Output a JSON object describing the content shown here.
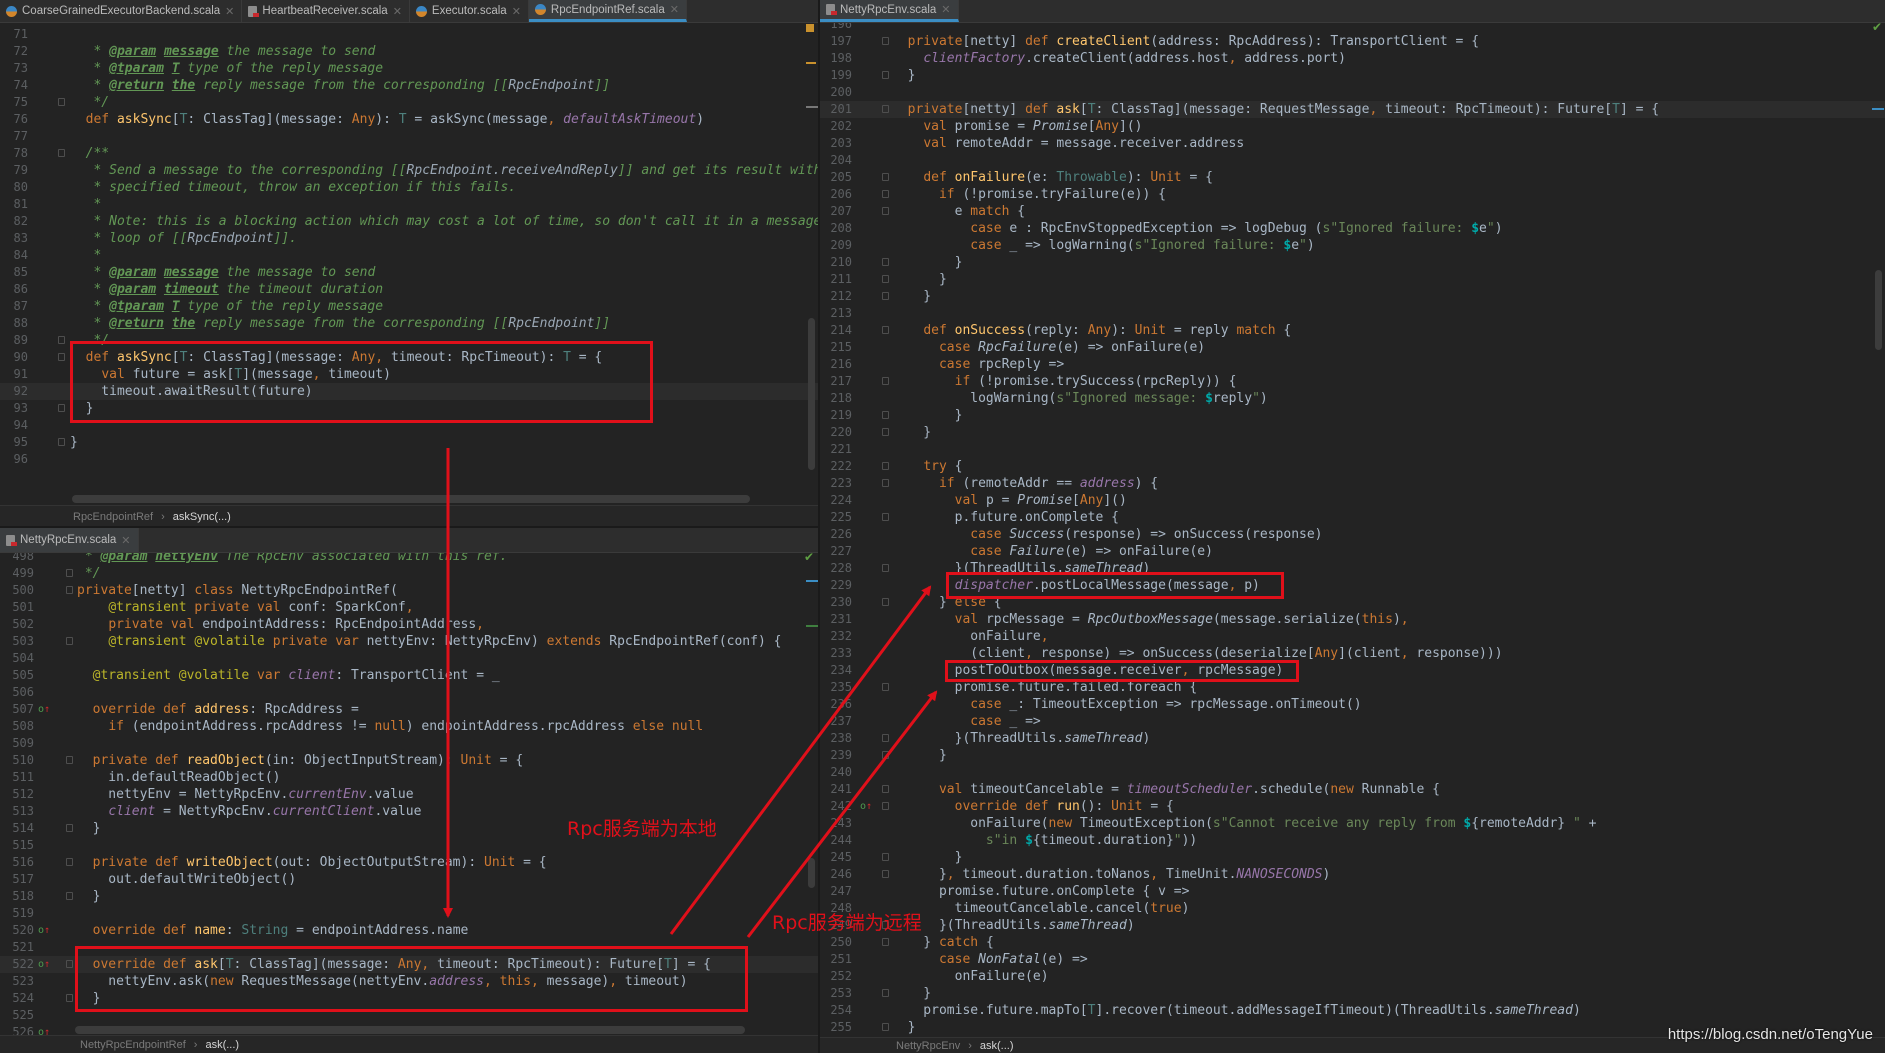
{
  "colors": {
    "annotation_red": "#e0101a",
    "active_tab_accent": "#3b8ec4",
    "background": "#232323"
  },
  "left_top": {
    "tabs": [
      {
        "label": "CoarseGrainedExecutorBackend.scala",
        "icon": "scala-class-icon",
        "active": false
      },
      {
        "label": "HeartbeatReceiver.scala",
        "icon": "scala-file-icon",
        "active": false
      },
      {
        "label": "Executor.scala",
        "icon": "scala-class-icon",
        "active": false
      },
      {
        "label": "RpcEndpointRef.scala",
        "icon": "scala-class-icon",
        "active": true
      }
    ],
    "first_line": 71,
    "current_line": 92,
    "lines": [
      "",
      "   * @param message the message to send",
      "   * @tparam T type of the reply message",
      "   * @return the reply message from the corresponding [[RpcEndpoint]]",
      "   */",
      "  def askSync[T: ClassTag](message: Any): T = askSync(message, defaultAskTimeout)",
      "",
      "  /**",
      "   * Send a message to the corresponding [[RpcEndpoint.receiveAndReply]] and get its result within a",
      "   * specified timeout, throw an exception if this fails.",
      "   *",
      "   * Note: this is a blocking action which may cost a lot of time, so don't call it in a message",
      "   * loop of [[RpcEndpoint]].",
      "   *",
      "   * @param message the message to send",
      "   * @param timeout the timeout duration",
      "   * @tparam T type of the reply message",
      "   * @return the reply message from the corresponding [[RpcEndpoint]]",
      "   */",
      "  def askSync[T: ClassTag](message: Any, timeout: RpcTimeout): T = {",
      "    val future = ask[T](message, timeout)",
      "    timeout.awaitResult(future)",
      "  }",
      "",
      "}",
      ""
    ],
    "breadcrumb": [
      "RpcEndpointRef",
      "askSync(...)"
    ]
  },
  "left_bottom": {
    "tabs": [
      {
        "label": "NettyRpcEnv.scala",
        "icon": "scala-file-icon",
        "active": false
      }
    ],
    "first_line": 498,
    "current_line": 522,
    "override_marks": [
      507,
      520,
      522,
      526
    ],
    "lines": [
      " * @param nettyEnv The RpcEnv associated with this ref.",
      " */",
      "private[netty] class NettyRpcEndpointRef(",
      "    @transient private val conf: SparkConf,",
      "    private val endpointAddress: RpcEndpointAddress,",
      "    @transient @volatile private var nettyEnv: NettyRpcEnv) extends RpcEndpointRef(conf) {",
      "",
      "  @transient @volatile var client: TransportClient = _",
      "",
      "  override def address: RpcAddress =",
      "    if (endpointAddress.rpcAddress != null) endpointAddress.rpcAddress else null",
      "",
      "  private def readObject(in: ObjectInputStream): Unit = {",
      "    in.defaultReadObject()",
      "    nettyEnv = NettyRpcEnv.currentEnv.value",
      "    client = NettyRpcEnv.currentClient.value",
      "  }",
      "",
      "  private def writeObject(out: ObjectOutputStream): Unit = {",
      "    out.defaultWriteObject()",
      "  }",
      "",
      "  override def name: String = endpointAddress.name",
      "",
      "  override def ask[T: ClassTag](message: Any, timeout: RpcTimeout): Future[T] = {",
      "    nettyEnv.ask(new RequestMessage(nettyEnv.address, this, message), timeout)",
      "  }",
      "",
      ""
    ],
    "breadcrumb": [
      "NettyRpcEndpointRef",
      "ask(...)"
    ]
  },
  "right": {
    "tabs": [
      {
        "label": "NettyRpcEnv.scala",
        "icon": "scala-file-icon",
        "active": true
      }
    ],
    "first_line": 196,
    "current_line": 201,
    "override_marks": [
      242
    ],
    "lines": [
      "",
      "  private[netty] def createClient(address: RpcAddress): TransportClient = {",
      "    clientFactory.createClient(address.host, address.port)",
      "  }",
      "",
      "  private[netty] def ask[T: ClassTag](message: RequestMessage, timeout: RpcTimeout): Future[T] = {",
      "    val promise = Promise[Any]()",
      "    val remoteAddr = message.receiver.address",
      "",
      "    def onFailure(e: Throwable): Unit = {",
      "      if (!promise.tryFailure(e)) {",
      "        e match {",
      "          case e : RpcEnvStoppedException => logDebug (s\"Ignored failure: $e\")",
      "          case _ => logWarning(s\"Ignored failure: $e\")",
      "        }",
      "      }",
      "    }",
      "",
      "    def onSuccess(reply: Any): Unit = reply match {",
      "      case RpcFailure(e) => onFailure(e)",
      "      case rpcReply =>",
      "        if (!promise.trySuccess(rpcReply)) {",
      "          logWarning(s\"Ignored message: $reply\")",
      "        }",
      "    }",
      "",
      "    try {",
      "      if (remoteAddr == address) {",
      "        val p = Promise[Any]()",
      "        p.future.onComplete {",
      "          case Success(response) => onSuccess(response)",
      "          case Failure(e) => onFailure(e)",
      "        }(ThreadUtils.sameThread)",
      "        dispatcher.postLocalMessage(message, p)",
      "      } else {",
      "        val rpcMessage = RpcOutboxMessage(message.serialize(this),",
      "          onFailure,",
      "          (client, response) => onSuccess(deserialize[Any](client, response)))",
      "        postToOutbox(message.receiver, rpcMessage)",
      "        promise.future.failed.foreach {",
      "          case _: TimeoutException => rpcMessage.onTimeout()",
      "          case _ =>",
      "        }(ThreadUtils.sameThread)",
      "      }",
      "",
      "      val timeoutCancelable = timeoutScheduler.schedule(new Runnable {",
      "        override def run(): Unit = {",
      "          onFailure(new TimeoutException(s\"Cannot receive any reply from ${remoteAddr} \" +",
      "            s\"in ${timeout.duration}\"))",
      "        }",
      "      }, timeout.duration.toNanos, TimeUnit.NANOSECONDS)",
      "      promise.future.onComplete { v =>",
      "        timeoutCancelable.cancel(true)",
      "      }(ThreadUtils.sameThread)",
      "    } catch {",
      "      case NonFatal(e) =>",
      "        onFailure(e)",
      "    }",
      "    promise.future.mapTo[T].recover(timeout.addMessageIfTimeout)(ThreadUtils.sameThread)",
      "  }"
    ],
    "breadcrumb": [
      "NettyRpcEnv",
      "ask(...)"
    ]
  },
  "annotations": {
    "local_label": "Rpc服务端为本地",
    "remote_label": "Rpc服务端为远程"
  },
  "watermark": "https://blog.csdn.net/oTengYue"
}
